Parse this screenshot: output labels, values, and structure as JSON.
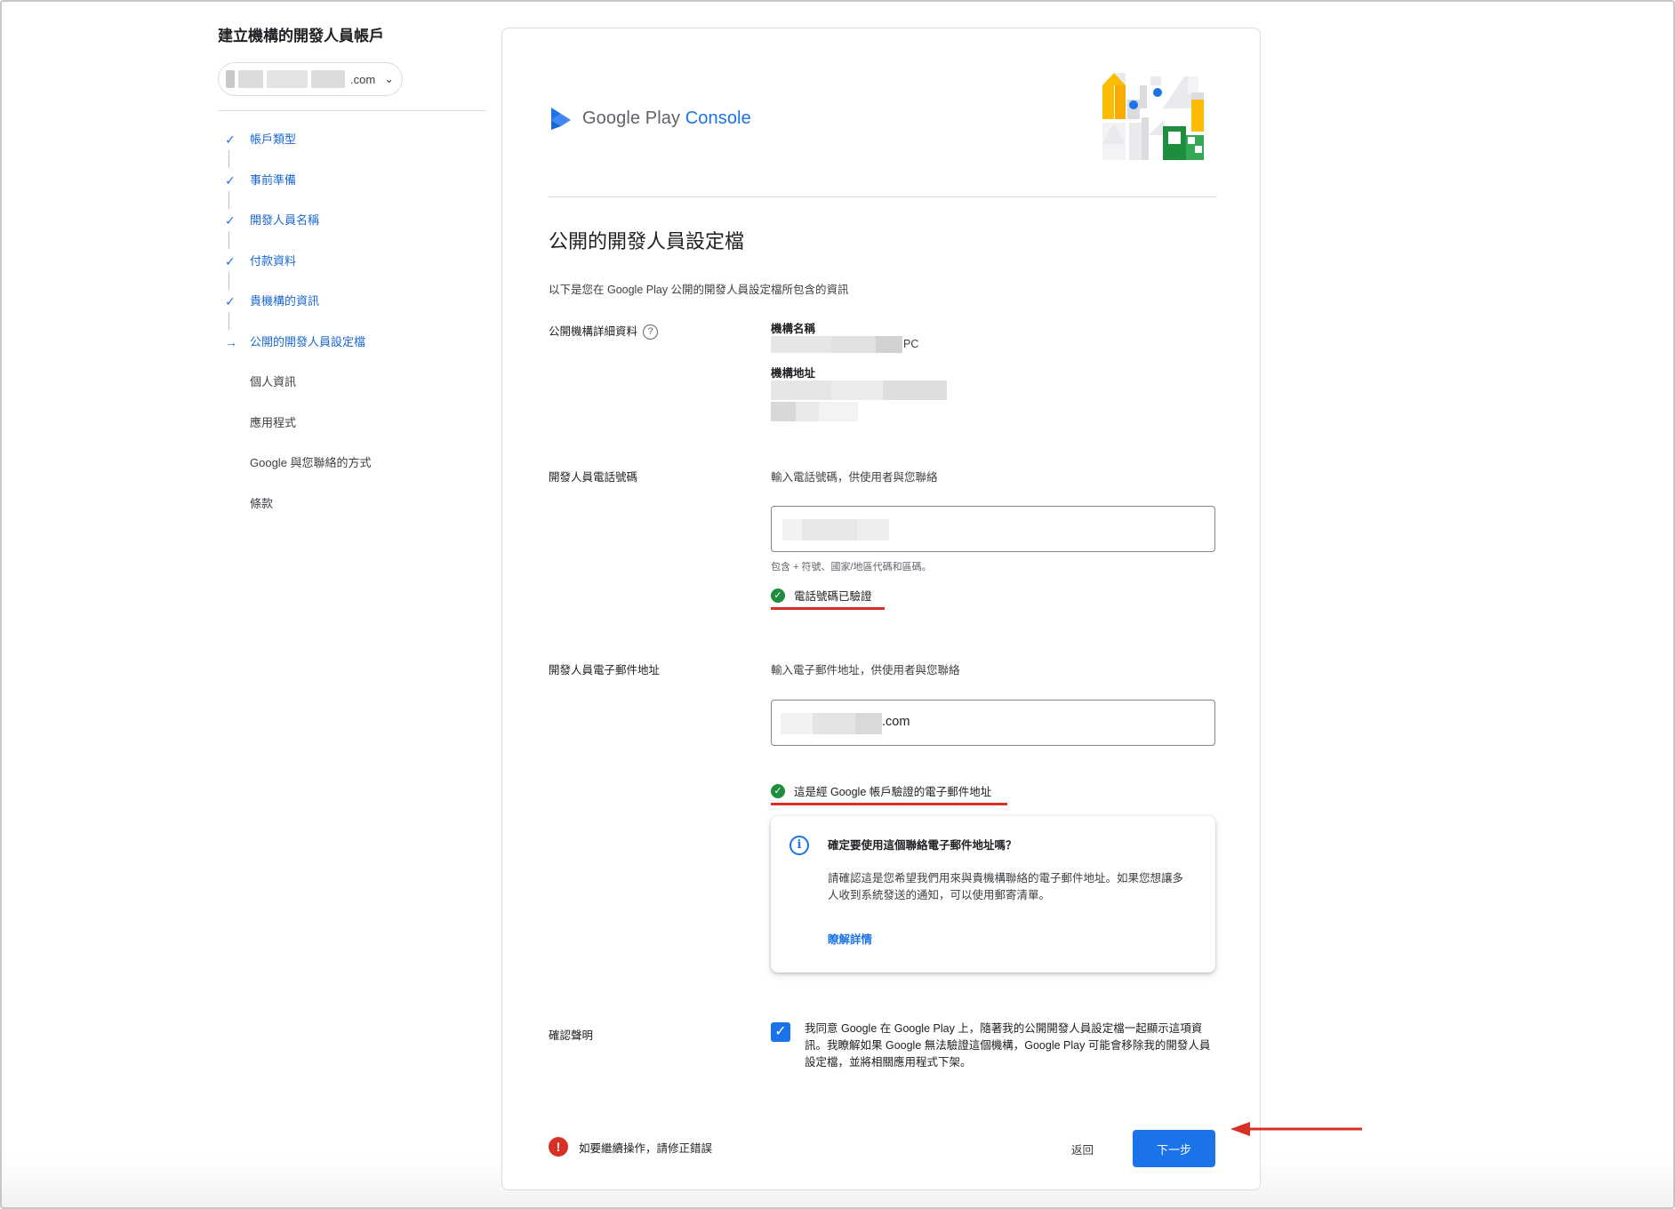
{
  "sidebar": {
    "title": "建立機構的開發人員帳戶",
    "account_domain": ".com",
    "steps": [
      {
        "label": "帳戶類型",
        "state": "done",
        "marker": "✓"
      },
      {
        "label": "事前準備",
        "state": "done",
        "marker": "✓"
      },
      {
        "label": "開發人員名稱",
        "state": "done",
        "marker": "✓"
      },
      {
        "label": "付款資料",
        "state": "done",
        "marker": "✓"
      },
      {
        "label": "貴機構的資訊",
        "state": "done",
        "marker": "✓"
      },
      {
        "label": "公開的開發人員設定檔",
        "state": "current",
        "marker": "→"
      },
      {
        "label": "個人資訊",
        "state": "todo",
        "marker": ""
      },
      {
        "label": "應用程式",
        "state": "todo",
        "marker": ""
      },
      {
        "label": "Google 與您聯絡的方式",
        "state": "todo",
        "marker": ""
      },
      {
        "label": "條款",
        "state": "todo",
        "marker": ""
      }
    ]
  },
  "brand": {
    "google_play": "Google Play",
    "console": "Console"
  },
  "main": {
    "title": "公開的開發人員設定檔",
    "intro": "以下是您在 Google Play 公開的開發人員設定檔所包含的資訊",
    "org_details": {
      "label": "公開機構詳細資料",
      "help_icon": "?",
      "name_label": "機構名稱",
      "name_value_suffix": "PC",
      "address_label": "機構地址"
    },
    "phone": {
      "label": "開發人員電話號碼",
      "prompt": "輸入電話號碼，供使用者與您聯絡",
      "helper": "包含 + 符號、國家/地區代碼和區碼。",
      "verified_text": "電話號碼已驗證"
    },
    "email": {
      "label": "開發人員電子郵件地址",
      "prompt": "輸入電子郵件地址，供使用者與您聯絡",
      "value_suffix": ".com",
      "verified_text": "這是經 Google 帳戶驗證的電子郵件地址"
    },
    "info_box": {
      "title": "確定要使用這個聯絡電子郵件地址嗎？",
      "body": "請確認這是您希望我們用來與貴機構聯絡的電子郵件地址。如果您想讓多人收到系統發送的通知，可以使用郵寄清單。",
      "link": "瞭解詳情"
    },
    "declaration": {
      "label": "確認聲明",
      "checked": true,
      "text": "我同意 Google 在 Google Play 上，隨著我的公開開發人員設定檔一起顯示這項資訊。我瞭解如果 Google 無法驗證這個機構，Google Play 可能會移除我的開發人員設定檔，並將相關應用程式下架。"
    },
    "footer": {
      "error_text": "如要繼續操作，請修正錯誤",
      "back_label": "返回",
      "next_label": "下一步"
    }
  },
  "colors": {
    "accent": "#1a73e8",
    "success": "#1e8e3e",
    "error": "#d93025"
  }
}
